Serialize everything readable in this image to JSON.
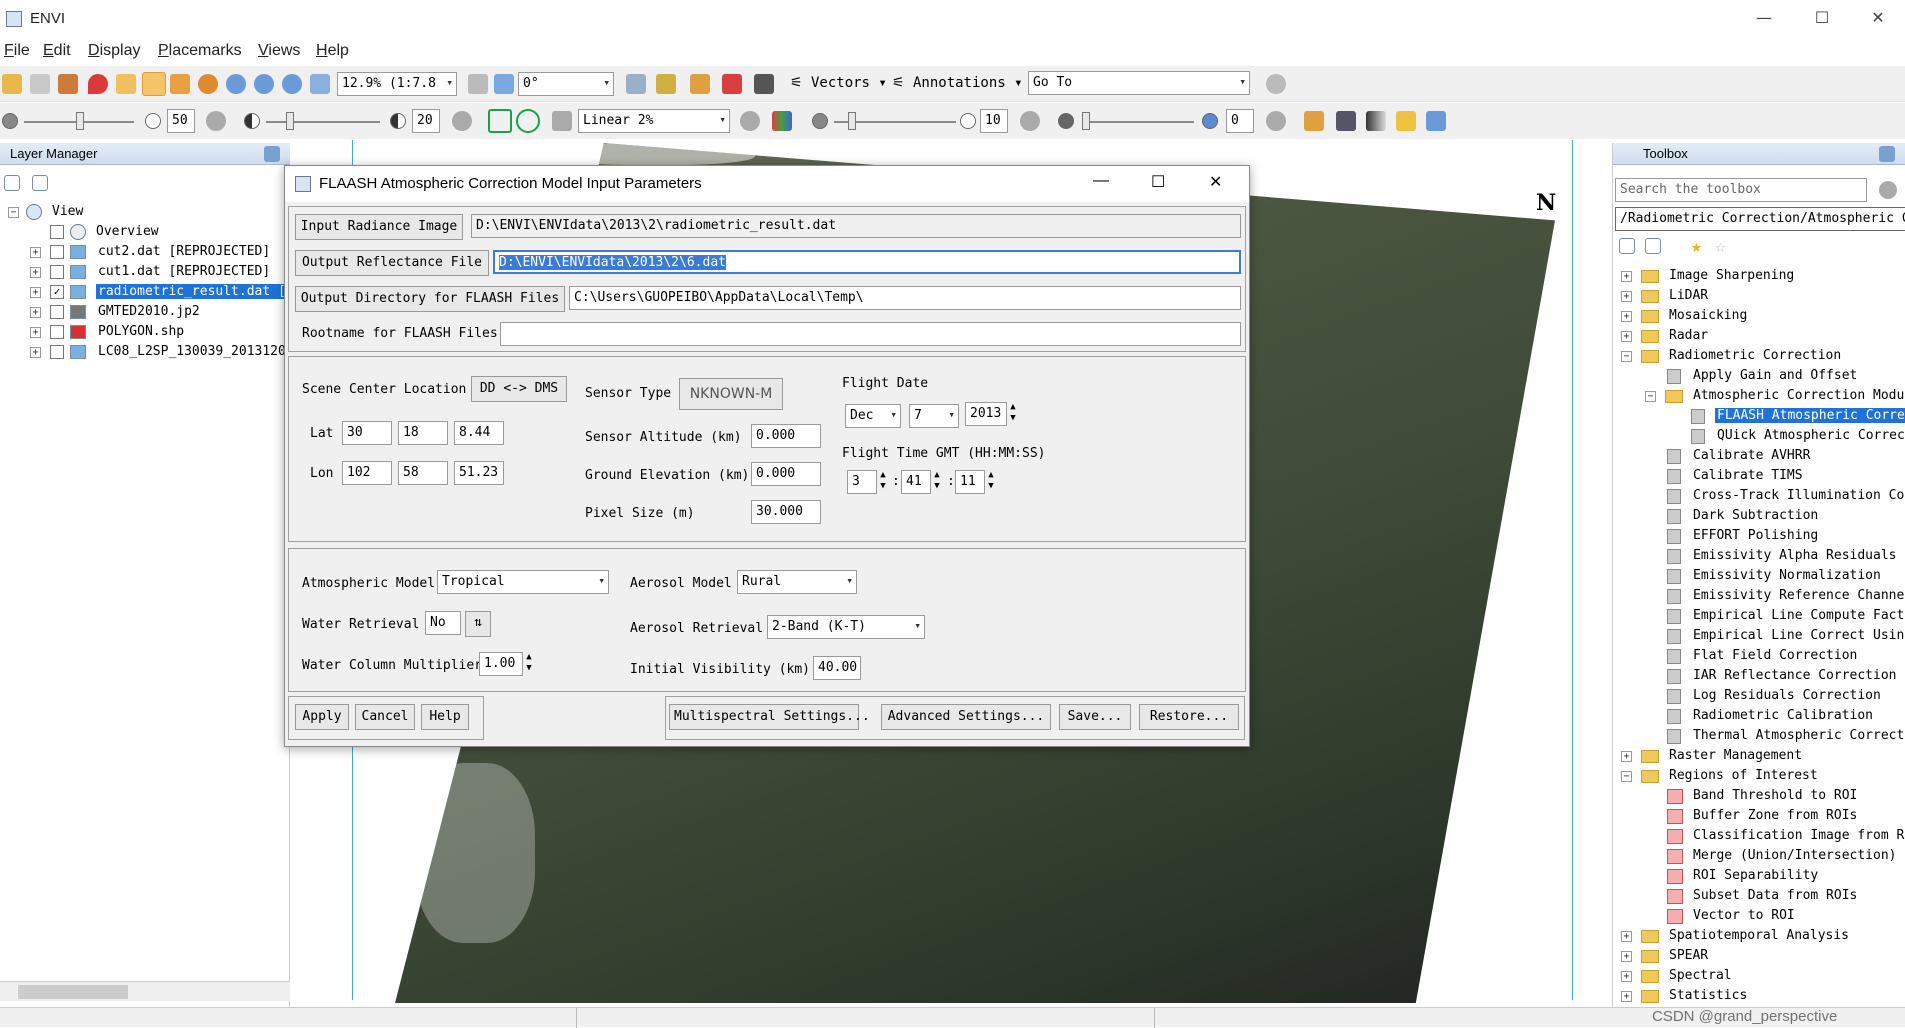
{
  "app": {
    "title": "ENVI"
  },
  "window_controls": {
    "minimize": "—",
    "maximize": "☐",
    "close": "✕"
  },
  "menu": [
    "File",
    "Edit",
    "Display",
    "Placemarks",
    "Views",
    "Help"
  ],
  "toolbar1": {
    "zoom_value": "12.9% (1:7.8",
    "rotation_value": "0°",
    "vectors_label": "Vectors",
    "annotations_label": "Annotations",
    "goto_value": "Go To"
  },
  "toolbar2": {
    "brightness_value": "50",
    "contrast_value": "20",
    "stretch_value": "Linear 2%",
    "sharpen_value": "10",
    "transparency_value": "0"
  },
  "layer_manager": {
    "title": "Layer Manager",
    "root": "View",
    "overview": "Overview",
    "layers": [
      {
        "name": "cut2.dat [REPROJECTED]",
        "checked": false
      },
      {
        "name": "cut1.dat [REPROJECTED]",
        "checked": false
      },
      {
        "name": "radiometric_result.dat [I",
        "checked": true
      },
      {
        "name": "GMTED2010.jp2",
        "checked": false
      },
      {
        "name": "POLYGON.shp",
        "checked": false
      },
      {
        "name": "LC08_L2SP_130039_20131207",
        "checked": false
      }
    ]
  },
  "viewport": {
    "north_label": "N"
  },
  "toolbox": {
    "title": "Toolbox",
    "search_placeholder": "Search the toolbox",
    "path": "/Radiometric Correction/Atmospheric Cor",
    "items": [
      {
        "label": "Image Sharpening",
        "level": 0,
        "type": "folder"
      },
      {
        "label": "LiDAR",
        "level": 0,
        "type": "folder"
      },
      {
        "label": "Mosaicking",
        "level": 0,
        "type": "folder"
      },
      {
        "label": "Radar",
        "level": 0,
        "type": "folder"
      },
      {
        "label": "Radiometric Correction",
        "level": 0,
        "type": "folder-open"
      },
      {
        "label": "Apply Gain and Offset",
        "level": 1,
        "type": "tool"
      },
      {
        "label": "Atmospheric Correction Modul",
        "level": 1,
        "type": "folder-open"
      },
      {
        "label": "FLAASH Atmospheric Correc",
        "level": 2,
        "type": "tool",
        "selected": true
      },
      {
        "label": "QUick Atmospheric Correct",
        "level": 2,
        "type": "tool"
      },
      {
        "label": "Calibrate AVHRR",
        "level": 1,
        "type": "tool"
      },
      {
        "label": "Calibrate TIMS",
        "level": 1,
        "type": "tool"
      },
      {
        "label": "Cross-Track Illumination Cor",
        "level": 1,
        "type": "tool"
      },
      {
        "label": "Dark Subtraction",
        "level": 1,
        "type": "tool"
      },
      {
        "label": "EFFORT Polishing",
        "level": 1,
        "type": "tool"
      },
      {
        "label": "Emissivity Alpha Residuals",
        "level": 1,
        "type": "tool"
      },
      {
        "label": "Emissivity Normalization",
        "level": 1,
        "type": "tool"
      },
      {
        "label": "Emissivity Reference Channel",
        "level": 1,
        "type": "tool"
      },
      {
        "label": "Empirical Line Compute Facto",
        "level": 1,
        "type": "tool"
      },
      {
        "label": "Empirical Line Correct Using",
        "level": 1,
        "type": "tool"
      },
      {
        "label": "Flat Field Correction",
        "level": 1,
        "type": "tool"
      },
      {
        "label": "IAR Reflectance Correction",
        "level": 1,
        "type": "tool"
      },
      {
        "label": "Log Residuals Correction",
        "level": 1,
        "type": "tool"
      },
      {
        "label": "Radiometric Calibration",
        "level": 1,
        "type": "tool"
      },
      {
        "label": "Thermal Atmospheric Correcti",
        "level": 1,
        "type": "tool"
      },
      {
        "label": "Raster Management",
        "level": 0,
        "type": "folder"
      },
      {
        "label": "Regions of Interest",
        "level": 0,
        "type": "folder-open"
      },
      {
        "label": "Band Threshold to ROI",
        "level": 1,
        "type": "roi"
      },
      {
        "label": "Buffer Zone from ROIs",
        "level": 1,
        "type": "roi"
      },
      {
        "label": "Classification Image from RO",
        "level": 1,
        "type": "roi"
      },
      {
        "label": "Merge (Union/Intersection) R",
        "level": 1,
        "type": "roi"
      },
      {
        "label": "ROI Separability",
        "level": 1,
        "type": "roi"
      },
      {
        "label": "Subset Data from ROIs",
        "level": 1,
        "type": "roi"
      },
      {
        "label": "Vector to ROI",
        "level": 1,
        "type": "roi"
      },
      {
        "label": "Spatiotemporal Analysis",
        "level": 0,
        "type": "folder"
      },
      {
        "label": "SPEAR",
        "level": 0,
        "type": "folder"
      },
      {
        "label": "Spectral",
        "level": 0,
        "type": "folder"
      },
      {
        "label": "Statistics",
        "level": 0,
        "type": "folder"
      }
    ]
  },
  "dialog": {
    "title": "FLAASH Atmospheric Correction Model Input Parameters",
    "input_radiance_label": "Input Radiance Image",
    "input_radiance_value": "D:\\ENVI\\ENVIdata\\2013\\2\\radiometric_result.dat",
    "output_reflectance_label": "Output Reflectance File",
    "output_reflectance_value": "D:\\ENVI\\ENVIdata\\2013\\2\\6.dat",
    "output_dir_label": "Output Directory for FLAASH Files",
    "output_dir_value": "C:\\Users\\GUOPEIBO\\AppData\\Local\\Temp\\",
    "rootname_label": "Rootname for FLAASH Files",
    "rootname_value": "",
    "scene_center_label": "Scene Center Location",
    "dd_dms_label": "DD <-> DMS",
    "lat_label": "Lat",
    "lat": [
      "30",
      "18",
      "8.44"
    ],
    "lon_label": "Lon",
    "lon": [
      "102",
      "58",
      "51.23"
    ],
    "sensor_type_label": "Sensor Type",
    "sensor_type_value": "NKNOWN-M",
    "sensor_altitude_label": "Sensor Altitude (km)",
    "sensor_altitude_value": "0.000",
    "ground_elevation_label": "Ground Elevation (km)",
    "ground_elevation_value": "0.000",
    "pixel_size_label": "Pixel Size (m)",
    "pixel_size_value": "30.000",
    "flight_date_label": "Flight Date",
    "flight_month": "Dec",
    "flight_day": "7",
    "flight_year": "2013",
    "flight_time_label": "Flight Time GMT (HH:MM:SS)",
    "flight_hh": "3",
    "flight_mm": "41",
    "flight_ss": "11",
    "time_sep": ":",
    "atm_model_label": "Atmospheric Model",
    "atm_model_value": "Tropical",
    "aerosol_model_label": "Aerosol Model",
    "aerosol_model_value": "Rural",
    "water_retrieval_label": "Water Retrieval",
    "water_retrieval_value": "No",
    "aerosol_retrieval_label": "Aerosol Retrieval",
    "aerosol_retrieval_value": "2-Band (K-T)",
    "water_col_label": "Water Column Multiplier",
    "water_col_value": "1.00",
    "initial_vis_label": "Initial Visibility (km)",
    "initial_vis_value": "40.00",
    "apply": "Apply",
    "cancel": "Cancel",
    "help": "Help",
    "multispectral": "Multispectral Settings...",
    "advanced": "Advanced Settings...",
    "save": "Save...",
    "restore": "Restore..."
  },
  "watermark": "CSDN @grand_perspective"
}
